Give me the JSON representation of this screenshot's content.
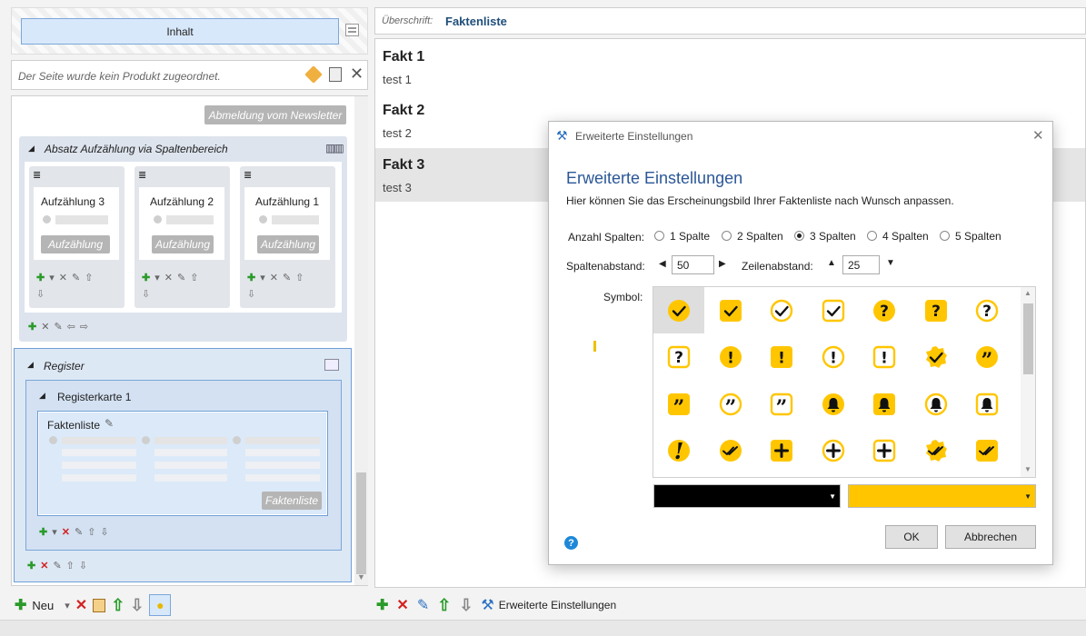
{
  "left": {
    "inhalt_label": "Inhalt",
    "product_notice": "Der Seite wurde kein Produkt zugeordnet.",
    "newsletter_button": "Abmeldung vom Newsletter",
    "absatz_title": "Absatz Aufzählung via Spaltenbereich",
    "columns": [
      {
        "title": "Aufzählung 3",
        "button": "Aufzählung"
      },
      {
        "title": "Aufzählung 2",
        "button": "Aufzählung"
      },
      {
        "title": "Aufzählung 1",
        "button": "Aufzählung"
      }
    ],
    "register_title": "Register",
    "registerkarte_title": "Registerkarte 1",
    "faktenliste_title": "Faktenliste",
    "faktenliste_button": "Faktenliste"
  },
  "bottom_left": {
    "new_label": "Neu"
  },
  "right": {
    "heading_label": "Überschrift:",
    "heading_value": "Faktenliste",
    "facts": [
      {
        "title": "Fakt 1",
        "text": "test 1"
      },
      {
        "title": "Fakt 2",
        "text": "test 2"
      },
      {
        "title": "Fakt 3",
        "text": "test 3"
      }
    ],
    "advanced_settings_label": "Erweiterte Einstellungen"
  },
  "dialog": {
    "window_title": "Erweiterte Einstellungen",
    "heading": "Erweiterte Einstellungen",
    "description": "Hier können Sie das Erscheinungsbild Ihrer Faktenliste nach Wunsch anpassen.",
    "columns_label": "Anzahl Spalten:",
    "column_options": [
      "1 Spalte",
      "2 Spalten",
      "3 Spalten",
      "4 Spalten",
      "5 Spalten"
    ],
    "selected_columns": "3 Spalten",
    "column_spacing_label": "Spaltenabstand:",
    "column_spacing_value": "50",
    "row_spacing_label": "Zeilenabstand:",
    "row_spacing_value": "25",
    "symbol_label": "Symbol:",
    "ok_label": "OK",
    "cancel_label": "Abbrechen",
    "color_primary": "#000000",
    "color_secondary": "#FFC600",
    "symbols": [
      "check-circle",
      "check-square",
      "check-circle-outline",
      "check-square-outline",
      "question-circle",
      "question-square",
      "question-circle-outline",
      "question-square-outline",
      "exclamation-circle",
      "exclamation-square",
      "exclamation-circle-outline",
      "exclamation-square-outline",
      "check-badge",
      "quote-circle",
      "quote-square",
      "quote-circle-outline",
      "quote-square-outline",
      "bell-circle",
      "bell-square",
      "bell-circle-outline",
      "bell-square-outline",
      "exclamation-large",
      "double-check-circle",
      "plus-square",
      "plus-circle-outline",
      "plus-square-outline",
      "double-check-badge",
      "double-check-square"
    ]
  }
}
